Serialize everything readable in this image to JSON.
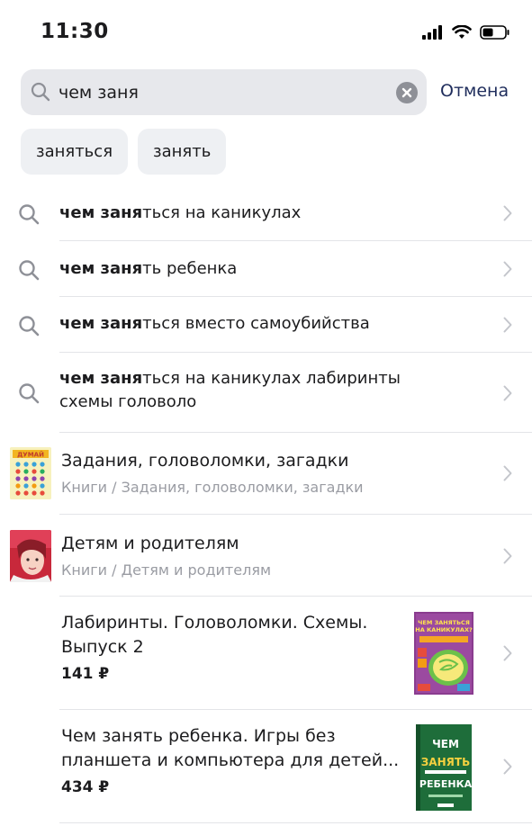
{
  "status_bar": {
    "time": "11:30"
  },
  "search": {
    "value": "чем заня",
    "cancel_label": "Отмена"
  },
  "chips": [
    "заняться",
    "занять"
  ],
  "suggestions": [
    {
      "bold": "чем заня",
      "rest": "ться на каникулах"
    },
    {
      "bold": "чем заня",
      "rest": "ть ребенка"
    },
    {
      "bold": "чем заня",
      "rest": "ться вместо самоубийства"
    },
    {
      "bold": "чем заня",
      "rest": "ться на каникулах лабиринты схемы головоло"
    }
  ],
  "categories": [
    {
      "title": "Задания, головоломки, загадки",
      "path": "Книги / Задания, головоломки, загадки",
      "thumb_text": "ДУМАЙ"
    },
    {
      "title": "Детям и родителям",
      "path": "Книги / Детям и родителям"
    }
  ],
  "products": [
    {
      "title": "Лабиринты. Головоломки. Схемы. Выпуск 2",
      "price": "141 ₽",
      "cover_text": "ЧЕМ ЗАНЯТЬСЯ НА КАНИКУЛАХ?"
    },
    {
      "title": "Чем занять ребенка. Игры без планшета и компьютера для детей...",
      "price": "434 ₽",
      "cover_text": "ЧЕМ ЗАНЯТЬ РЕБЕНКА"
    }
  ],
  "colors": {
    "accent": "#1f2d5c",
    "secondary_text": "#9a9ca3",
    "search_bg": "#e7e8ec"
  }
}
